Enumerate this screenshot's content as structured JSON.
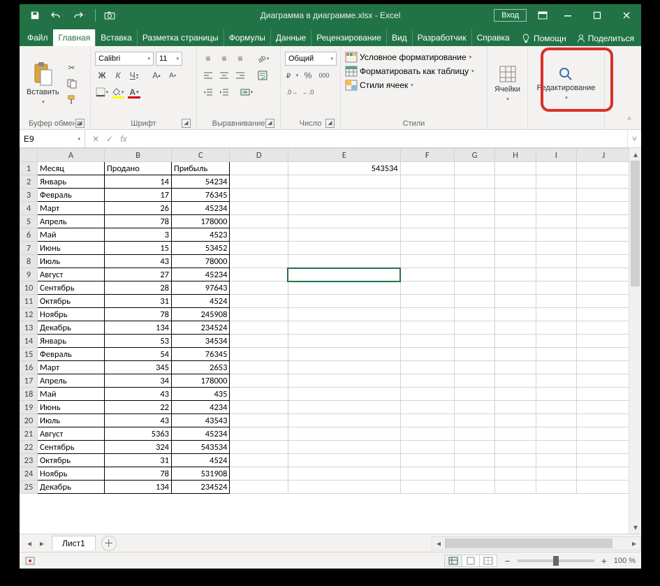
{
  "titlebar": {
    "title": "Диаграмма в диаграмме.xlsx - Excel",
    "login": "Вход"
  },
  "tabs": {
    "file": "Файл",
    "home": "Главная",
    "insert": "Вставка",
    "layout": "Разметка страницы",
    "formulas": "Формулы",
    "data": "Данные",
    "review": "Рецензирование",
    "view": "Вид",
    "developer": "Разработчик",
    "help": "Справка",
    "tell": "Помощн",
    "share": "Поделиться"
  },
  "ribbon": {
    "clipboard": {
      "paste": "Вставить",
      "group": "Буфер обмена"
    },
    "font": {
      "name": "Calibri",
      "size": "11",
      "group": "Шрифт"
    },
    "alignment": {
      "group": "Выравнивание"
    },
    "number": {
      "format": "Общий",
      "group": "Число"
    },
    "styles": {
      "cond": "Условное форматирование",
      "table": "Форматировать как таблицу",
      "cell": "Стили ячеек",
      "group": "Стили"
    },
    "cells": {
      "group": "Ячейки"
    },
    "editing": {
      "group": "Редактирование"
    }
  },
  "formulabar": {
    "namebox": "E9",
    "fx": "fx",
    "value": ""
  },
  "columns": [
    "A",
    "B",
    "C",
    "D",
    "E",
    "F",
    "G",
    "H",
    "I",
    "J"
  ],
  "sheet": {
    "headers": [
      "Месяц",
      "Продано",
      "Прибыль"
    ],
    "e1": "543534",
    "rows": [
      {
        "m": "Январь",
        "s": 14,
        "p": 54234
      },
      {
        "m": "Февраль",
        "s": 17,
        "p": 76345
      },
      {
        "m": "Март",
        "s": 26,
        "p": 45234
      },
      {
        "m": "Апрель",
        "s": 78,
        "p": 178000
      },
      {
        "m": "Май",
        "s": 3,
        "p": 4523
      },
      {
        "m": "Июнь",
        "s": 15,
        "p": 53452
      },
      {
        "m": "Июль",
        "s": 43,
        "p": 78000
      },
      {
        "m": "Август",
        "s": 27,
        "p": 45234
      },
      {
        "m": "Сентябрь",
        "s": 28,
        "p": 97643
      },
      {
        "m": "Октябрь",
        "s": 31,
        "p": 4524
      },
      {
        "m": "Ноябрь",
        "s": 78,
        "p": 245908
      },
      {
        "m": "Декабрь",
        "s": 134,
        "p": 234524
      },
      {
        "m": "Январь",
        "s": 53,
        "p": 34534
      },
      {
        "m": "Февраль",
        "s": 54,
        "p": 76345
      },
      {
        "m": "Март",
        "s": 345,
        "p": 2653
      },
      {
        "m": "Апрель",
        "s": 34,
        "p": 178000
      },
      {
        "m": "Май",
        "s": 43,
        "p": 435
      },
      {
        "m": "Июнь",
        "s": 22,
        "p": 4234
      },
      {
        "m": "Июль",
        "s": 43,
        "p": 43543
      },
      {
        "m": "Август",
        "s": 5363,
        "p": 45234
      },
      {
        "m": "Сентябрь",
        "s": 324,
        "p": 543534
      },
      {
        "m": "Октябрь",
        "s": 31,
        "p": 4524
      },
      {
        "m": "Ноябрь",
        "s": 78,
        "p": 531908
      },
      {
        "m": "Декабрь",
        "s": 134,
        "p": 234524
      }
    ]
  },
  "sheettab": "Лист1",
  "selected_cell": "E9",
  "status": {
    "zoom": "100 %"
  }
}
